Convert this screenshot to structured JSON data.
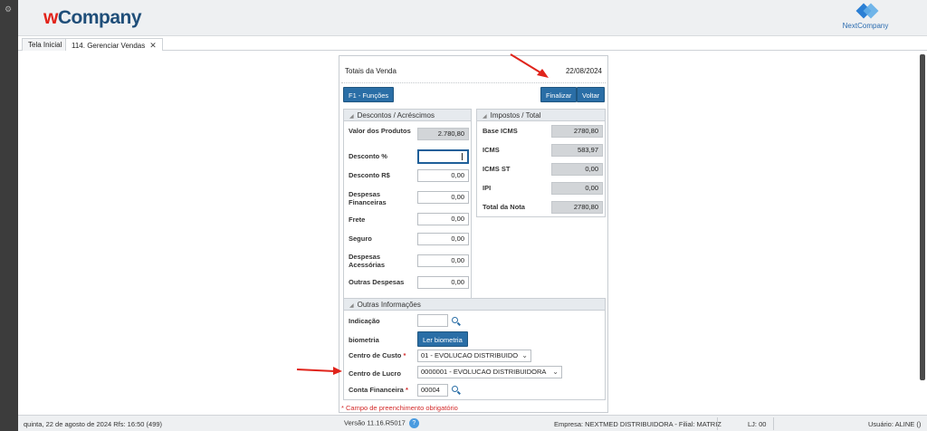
{
  "app": {
    "logo_w": "w",
    "logo_company": "Company",
    "partner_logo": "NextCompany"
  },
  "tabs": [
    {
      "label": "Tela Inicial"
    },
    {
      "label": "114. Gerenciar Vendas",
      "close": "✕"
    }
  ],
  "panel": {
    "title": "Totais da Venda",
    "date": "22/08/2024",
    "buttons": {
      "functions": "F1 - Funções",
      "finalize": "Finalizar",
      "back": "Voltar"
    }
  },
  "descontos": {
    "header": "Descontos / Acréscimos",
    "fields": [
      {
        "label": "Valor dos Produtos",
        "value": "2.780,80"
      },
      {
        "label": "Desconto %",
        "value": ""
      },
      {
        "label": "Desconto R$",
        "value": "0,00"
      },
      {
        "label": "Despesas Financeiras",
        "value": "0,00"
      },
      {
        "label": "Frete",
        "value": "0,00"
      },
      {
        "label": "Seguro",
        "value": "0,00"
      },
      {
        "label": "Despesas Acessórias",
        "value": "0,00"
      },
      {
        "label": "Outras Despesas",
        "value": "0,00"
      }
    ]
  },
  "impostos": {
    "header": "Impostos / Total",
    "fields": [
      {
        "label": "Base ICMS",
        "value": "2780,80"
      },
      {
        "label": "ICMS",
        "value": "583,97"
      },
      {
        "label": "ICMS ST",
        "value": "0,00"
      },
      {
        "label": "IPI",
        "value": "0,00"
      },
      {
        "label": "Total da Nota",
        "value": "2780,80"
      }
    ]
  },
  "outras": {
    "header": "Outras Informações",
    "indicacao_label": "Indicação",
    "indicacao_value": "",
    "biometria_label": "biometria",
    "biometria_button": "Ler biometria",
    "centro_custo_label": "Centro de Custo",
    "centro_custo_value": "01 - EVOLUCAO DISTRIBUIDO",
    "centro_lucro_label": "Centro de Lucro",
    "centro_lucro_value": "0000001 - EVOLUCAO DISTRIBUIDORA",
    "conta_label": "Conta Financeira",
    "conta_value": "00004",
    "required_mark": "*"
  },
  "required_note": "* Campo de preenchimento obrigatório",
  "status": {
    "datetime": "quinta, 22 de agosto de 2024  Rfs: 16:50 (499)",
    "version": "Versão 11.16.R5017",
    "help": "?",
    "company": "Empresa: NEXTMED DISTRIBUIDORA - Filial: MATRIZ",
    "lj": "LJ: 00",
    "user": "Usuário: ALINE ()"
  },
  "colors": {
    "accent": "#2a6ea6",
    "annotation_arrow": "#e0241b"
  }
}
